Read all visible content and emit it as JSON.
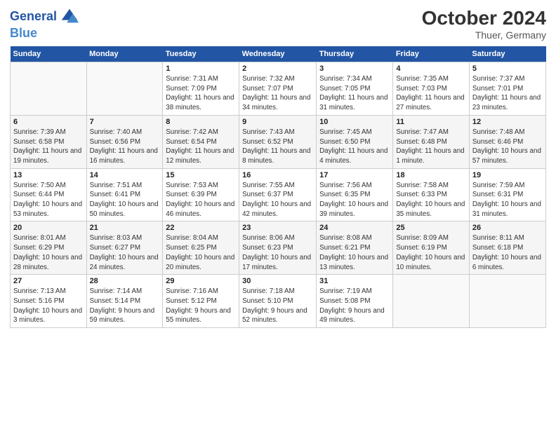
{
  "logo": {
    "line1": "General",
    "line2": "Blue"
  },
  "title": "October 2024",
  "location": "Thuer, Germany",
  "days_header": [
    "Sunday",
    "Monday",
    "Tuesday",
    "Wednesday",
    "Thursday",
    "Friday",
    "Saturday"
  ],
  "weeks": [
    [
      {
        "num": "",
        "sunrise": "",
        "sunset": "",
        "daylight": ""
      },
      {
        "num": "",
        "sunrise": "",
        "sunset": "",
        "daylight": ""
      },
      {
        "num": "1",
        "sunrise": "Sunrise: 7:31 AM",
        "sunset": "Sunset: 7:09 PM",
        "daylight": "Daylight: 11 hours and 38 minutes."
      },
      {
        "num": "2",
        "sunrise": "Sunrise: 7:32 AM",
        "sunset": "Sunset: 7:07 PM",
        "daylight": "Daylight: 11 hours and 34 minutes."
      },
      {
        "num": "3",
        "sunrise": "Sunrise: 7:34 AM",
        "sunset": "Sunset: 7:05 PM",
        "daylight": "Daylight: 11 hours and 31 minutes."
      },
      {
        "num": "4",
        "sunrise": "Sunrise: 7:35 AM",
        "sunset": "Sunset: 7:03 PM",
        "daylight": "Daylight: 11 hours and 27 minutes."
      },
      {
        "num": "5",
        "sunrise": "Sunrise: 7:37 AM",
        "sunset": "Sunset: 7:01 PM",
        "daylight": "Daylight: 11 hours and 23 minutes."
      }
    ],
    [
      {
        "num": "6",
        "sunrise": "Sunrise: 7:39 AM",
        "sunset": "Sunset: 6:58 PM",
        "daylight": "Daylight: 11 hours and 19 minutes."
      },
      {
        "num": "7",
        "sunrise": "Sunrise: 7:40 AM",
        "sunset": "Sunset: 6:56 PM",
        "daylight": "Daylight: 11 hours and 16 minutes."
      },
      {
        "num": "8",
        "sunrise": "Sunrise: 7:42 AM",
        "sunset": "Sunset: 6:54 PM",
        "daylight": "Daylight: 11 hours and 12 minutes."
      },
      {
        "num": "9",
        "sunrise": "Sunrise: 7:43 AM",
        "sunset": "Sunset: 6:52 PM",
        "daylight": "Daylight: 11 hours and 8 minutes."
      },
      {
        "num": "10",
        "sunrise": "Sunrise: 7:45 AM",
        "sunset": "Sunset: 6:50 PM",
        "daylight": "Daylight: 11 hours and 4 minutes."
      },
      {
        "num": "11",
        "sunrise": "Sunrise: 7:47 AM",
        "sunset": "Sunset: 6:48 PM",
        "daylight": "Daylight: 11 hours and 1 minute."
      },
      {
        "num": "12",
        "sunrise": "Sunrise: 7:48 AM",
        "sunset": "Sunset: 6:46 PM",
        "daylight": "Daylight: 10 hours and 57 minutes."
      }
    ],
    [
      {
        "num": "13",
        "sunrise": "Sunrise: 7:50 AM",
        "sunset": "Sunset: 6:44 PM",
        "daylight": "Daylight: 10 hours and 53 minutes."
      },
      {
        "num": "14",
        "sunrise": "Sunrise: 7:51 AM",
        "sunset": "Sunset: 6:41 PM",
        "daylight": "Daylight: 10 hours and 50 minutes."
      },
      {
        "num": "15",
        "sunrise": "Sunrise: 7:53 AM",
        "sunset": "Sunset: 6:39 PM",
        "daylight": "Daylight: 10 hours and 46 minutes."
      },
      {
        "num": "16",
        "sunrise": "Sunrise: 7:55 AM",
        "sunset": "Sunset: 6:37 PM",
        "daylight": "Daylight: 10 hours and 42 minutes."
      },
      {
        "num": "17",
        "sunrise": "Sunrise: 7:56 AM",
        "sunset": "Sunset: 6:35 PM",
        "daylight": "Daylight: 10 hours and 39 minutes."
      },
      {
        "num": "18",
        "sunrise": "Sunrise: 7:58 AM",
        "sunset": "Sunset: 6:33 PM",
        "daylight": "Daylight: 10 hours and 35 minutes."
      },
      {
        "num": "19",
        "sunrise": "Sunrise: 7:59 AM",
        "sunset": "Sunset: 6:31 PM",
        "daylight": "Daylight: 10 hours and 31 minutes."
      }
    ],
    [
      {
        "num": "20",
        "sunrise": "Sunrise: 8:01 AM",
        "sunset": "Sunset: 6:29 PM",
        "daylight": "Daylight: 10 hours and 28 minutes."
      },
      {
        "num": "21",
        "sunrise": "Sunrise: 8:03 AM",
        "sunset": "Sunset: 6:27 PM",
        "daylight": "Daylight: 10 hours and 24 minutes."
      },
      {
        "num": "22",
        "sunrise": "Sunrise: 8:04 AM",
        "sunset": "Sunset: 6:25 PM",
        "daylight": "Daylight: 10 hours and 20 minutes."
      },
      {
        "num": "23",
        "sunrise": "Sunrise: 8:06 AM",
        "sunset": "Sunset: 6:23 PM",
        "daylight": "Daylight: 10 hours and 17 minutes."
      },
      {
        "num": "24",
        "sunrise": "Sunrise: 8:08 AM",
        "sunset": "Sunset: 6:21 PM",
        "daylight": "Daylight: 10 hours and 13 minutes."
      },
      {
        "num": "25",
        "sunrise": "Sunrise: 8:09 AM",
        "sunset": "Sunset: 6:19 PM",
        "daylight": "Daylight: 10 hours and 10 minutes."
      },
      {
        "num": "26",
        "sunrise": "Sunrise: 8:11 AM",
        "sunset": "Sunset: 6:18 PM",
        "daylight": "Daylight: 10 hours and 6 minutes."
      }
    ],
    [
      {
        "num": "27",
        "sunrise": "Sunrise: 7:13 AM",
        "sunset": "Sunset: 5:16 PM",
        "daylight": "Daylight: 10 hours and 3 minutes."
      },
      {
        "num": "28",
        "sunrise": "Sunrise: 7:14 AM",
        "sunset": "Sunset: 5:14 PM",
        "daylight": "Daylight: 9 hours and 59 minutes."
      },
      {
        "num": "29",
        "sunrise": "Sunrise: 7:16 AM",
        "sunset": "Sunset: 5:12 PM",
        "daylight": "Daylight: 9 hours and 55 minutes."
      },
      {
        "num": "30",
        "sunrise": "Sunrise: 7:18 AM",
        "sunset": "Sunset: 5:10 PM",
        "daylight": "Daylight: 9 hours and 52 minutes."
      },
      {
        "num": "31",
        "sunrise": "Sunrise: 7:19 AM",
        "sunset": "Sunset: 5:08 PM",
        "daylight": "Daylight: 9 hours and 49 minutes."
      },
      {
        "num": "",
        "sunrise": "",
        "sunset": "",
        "daylight": ""
      },
      {
        "num": "",
        "sunrise": "",
        "sunset": "",
        "daylight": ""
      }
    ]
  ]
}
